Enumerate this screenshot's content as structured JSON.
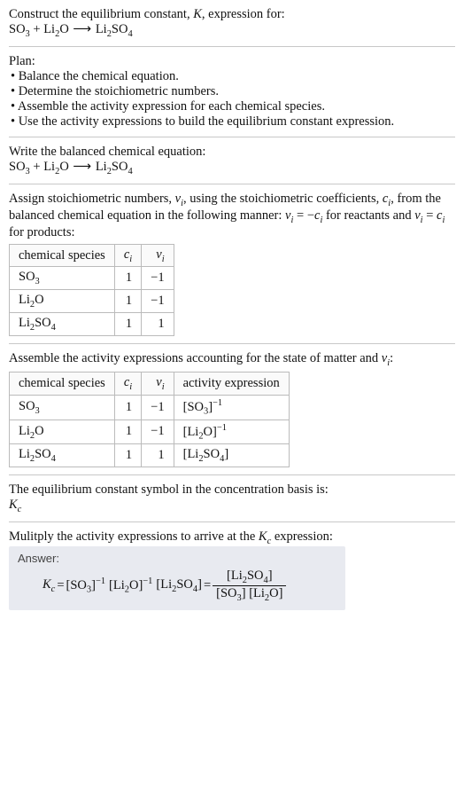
{
  "header": {
    "line1_pre": "Construct the equilibrium constant, ",
    "line1_K": "K",
    "line1_post": ", expression for:",
    "eq_lhs_a": "SO",
    "eq_lhs_a_sub": "3",
    "eq_plus": " + ",
    "eq_lhs_b": "Li",
    "eq_lhs_b_sub": "2",
    "eq_lhs_b2": "O",
    "eq_arrow": " ⟶ ",
    "eq_rhs": "Li",
    "eq_rhs_sub1": "2",
    "eq_rhs_mid": "SO",
    "eq_rhs_sub2": "4"
  },
  "plan": {
    "title": "Plan:",
    "b1": "• Balance the chemical equation.",
    "b2": "• Determine the stoichiometric numbers.",
    "b3": "• Assemble the activity expression for each chemical species.",
    "b4": "• Use the activity expressions to build the equilibrium constant expression."
  },
  "balanced": {
    "intro": "Write the balanced chemical equation:"
  },
  "assign": {
    "text1": "Assign stoichiometric numbers, ",
    "nu": "ν",
    "sub_i": "i",
    "text2": ", using the stoichiometric coefficients, ",
    "c": "c",
    "text3": ", from the balanced chemical equation in the following manner: ",
    "rel1a": "ν",
    "rel1_eq": " = −",
    "rel1b": "c",
    "text4": " for reactants and ",
    "rel2_eq": " = ",
    "text5": " for products:"
  },
  "table1": {
    "h1": "chemical species",
    "h2": "c",
    "h2_sub": "i",
    "h3": "ν",
    "h3_sub": "i",
    "rows": [
      {
        "sp_a": "SO",
        "sp_asub": "3",
        "sp_b": "",
        "sp_bsub": "",
        "c": "1",
        "nu": "−1"
      },
      {
        "sp_a": "Li",
        "sp_asub": "2",
        "sp_b": "O",
        "sp_bsub": "",
        "c": "1",
        "nu": "−1"
      },
      {
        "sp_a": "Li",
        "sp_asub": "2",
        "sp_b": "SO",
        "sp_bsub": "4",
        "c": "1",
        "nu": "1"
      }
    ]
  },
  "assemble": {
    "text1": "Assemble the activity expressions accounting for the state of matter and ",
    "nu": "ν",
    "sub_i": "i",
    "text2": ":"
  },
  "table2": {
    "h1": "chemical species",
    "h2": "c",
    "h2_sub": "i",
    "h3": "ν",
    "h3_sub": "i",
    "h4": "activity expression",
    "rows": [
      {
        "sp_a": "SO",
        "sp_asub": "3",
        "sp_b": "",
        "sp_bsub": "",
        "c": "1",
        "nu": "−1",
        "act_a": "[SO",
        "act_asub": "3",
        "act_b": "]",
        "act_bsub": "",
        "exp": "−1"
      },
      {
        "sp_a": "Li",
        "sp_asub": "2",
        "sp_b": "O",
        "sp_bsub": "",
        "c": "1",
        "nu": "−1",
        "act_a": "[Li",
        "act_asub": "2",
        "act_b": "O]",
        "act_bsub": "",
        "exp": "−1"
      },
      {
        "sp_a": "Li",
        "sp_asub": "2",
        "sp_b": "SO",
        "sp_bsub": "4",
        "c": "1",
        "nu": "1",
        "act_a": "[Li",
        "act_asub": "2",
        "act_b": "SO",
        "act_bsub": "4",
        "act_close": "]",
        "exp": ""
      }
    ]
  },
  "symbol": {
    "text": "The equilibrium constant symbol in the concentration basis is:",
    "K": "K",
    "Ksub": "c"
  },
  "multiply": {
    "text1": "Mulitply the activity expressions to arrive at the ",
    "K": "K",
    "Ksub": "c",
    "text2": " expression:"
  },
  "answer": {
    "label": "Answer:",
    "K": "K",
    "Ksub": "c",
    "eq": " = ",
    "t1": "[SO",
    "t1sub": "3",
    "t1close": "]",
    "t1exp": "−1",
    "sp": " ",
    "t2": "[Li",
    "t2sub": "2",
    "t2mid": "O]",
    "t2exp": "−1",
    "t3": "[Li",
    "t3sub": "2",
    "t3mid": "SO",
    "t3sub2": "4",
    "t3close": "]",
    "eq2": " = ",
    "num": {
      "a": "[Li",
      "asub": "2",
      "b": "SO",
      "bsub": "4",
      "c": "]"
    },
    "den": {
      "a": "[SO",
      "asub": "3",
      "b": "] [Li",
      "bsub": "2",
      "c": "O]"
    }
  }
}
